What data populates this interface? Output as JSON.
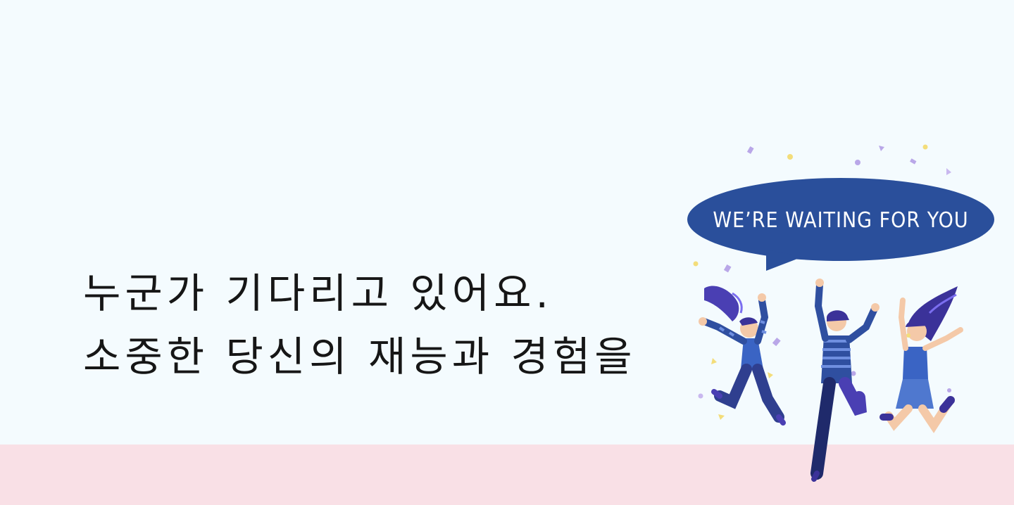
{
  "headline": {
    "line1": "누군가 기다리고 있어요.",
    "line2": "소중한 당신의 재능과 경험을"
  },
  "bubble": {
    "text": "WE’RE WAITING FOR YOU"
  },
  "colors": {
    "background": "#f4fbfe",
    "floor": "#f9e0e6",
    "bubble": "#2a4f9b",
    "text": "#161616"
  }
}
